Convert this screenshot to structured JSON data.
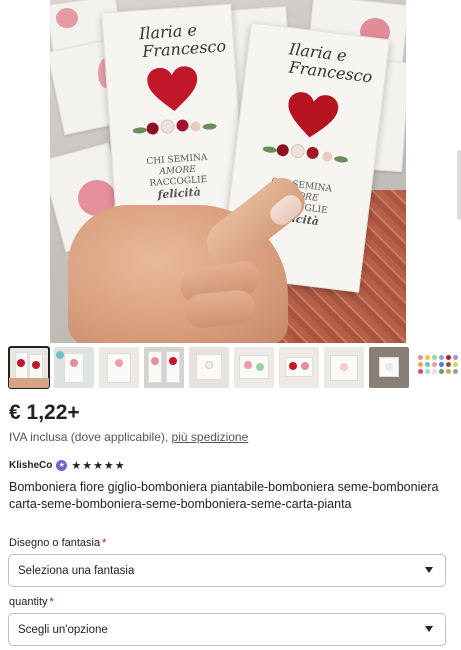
{
  "product": {
    "price": "€ 1,22+",
    "tax_text": "IVA inclusa (dove applicabile),",
    "shipping_link": "più spedizione",
    "seller_name": "KlisheCo",
    "star_seller_icon": "star-seller-badge-icon",
    "rating_stars": "★★★★★",
    "title": "Bomboniera fiore giglio-bomboniera piantabile-bomboniera seme-bomboniera carta-seme-bomboniera-seme-bomboniera-seme-carta-pianta"
  },
  "image_text": {
    "names": "Ilaria e Francesco",
    "name_a": "Ilaria",
    "conj": "e",
    "name_b": "Francesco",
    "motto_1": "CHI SEMINA",
    "motto_2": "AMORE",
    "motto_3": "RACCOGLIE",
    "motto_4": "felicità"
  },
  "thumbnails": {
    "count": 10,
    "selected_index": 0
  },
  "options": [
    {
      "label": "Disegno o fantasia",
      "required_mark": "*",
      "value": "Seleziona una fantasia"
    },
    {
      "label": "quantity",
      "required_mark": "*",
      "value": "Scegli un'opzione"
    }
  ],
  "colors": {
    "required": "#a61a2e",
    "star_seller_badge": "#7b5bd6",
    "heart_red": "#c0182a",
    "felt_pink": "#e58f9a"
  }
}
